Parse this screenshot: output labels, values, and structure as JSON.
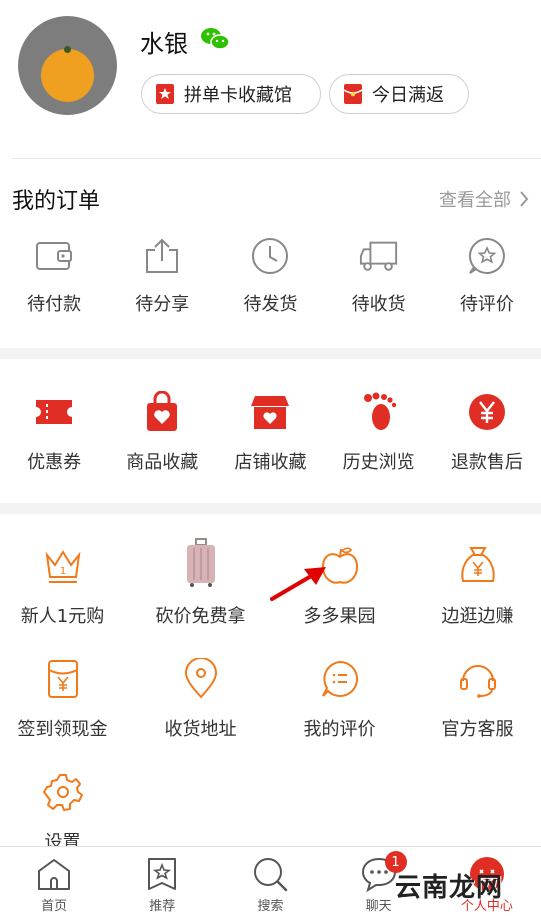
{
  "profile": {
    "username": "水银",
    "chips": [
      {
        "label": "拼单卡收藏馆",
        "icon": "card-icon"
      },
      {
        "label": "今日满返",
        "icon": "red-envelope-icon"
      }
    ]
  },
  "orders": {
    "title": "我的订单",
    "view_all": "查看全部",
    "items": [
      {
        "label": "待付款",
        "icon": "wallet-icon"
      },
      {
        "label": "待分享",
        "icon": "share-icon"
      },
      {
        "label": "待发货",
        "icon": "clock-icon"
      },
      {
        "label": "待收货",
        "icon": "truck-icon"
      },
      {
        "label": "待评价",
        "icon": "star-bubble-icon"
      }
    ]
  },
  "quick": {
    "items": [
      {
        "label": "优惠券",
        "icon": "coupon-icon"
      },
      {
        "label": "商品收藏",
        "icon": "bag-heart-icon"
      },
      {
        "label": "店铺收藏",
        "icon": "shop-heart-icon"
      },
      {
        "label": "历史浏览",
        "icon": "footprint-icon"
      },
      {
        "label": "退款售后",
        "icon": "yuan-circle-icon"
      }
    ]
  },
  "services": {
    "items": [
      {
        "label": "新人1元购",
        "icon": "crown-icon"
      },
      {
        "label": "砍价免费拿",
        "icon": "suitcase-icon"
      },
      {
        "label": "多多果园",
        "icon": "apple-icon"
      },
      {
        "label": "边逛边赚",
        "icon": "money-bag-icon"
      },
      {
        "label": "签到领现金",
        "icon": "envelope-yuan-icon"
      },
      {
        "label": "收货地址",
        "icon": "location-pin-icon"
      },
      {
        "label": "我的评价",
        "icon": "comment-icon"
      },
      {
        "label": "官方客服",
        "icon": "headset-icon"
      },
      {
        "label": "设置",
        "icon": "gear-icon"
      }
    ]
  },
  "tabbar": {
    "items": [
      {
        "label": "首页",
        "icon": "home-icon"
      },
      {
        "label": "推荐",
        "icon": "recommend-icon"
      },
      {
        "label": "搜索",
        "icon": "search-icon"
      },
      {
        "label": "聊天",
        "icon": "chat-icon",
        "badge": "1"
      },
      {
        "label": "个人中心",
        "icon": "profile-icon",
        "active": true
      }
    ]
  },
  "watermark": "云南龙网",
  "colors": {
    "accent": "#e02e24",
    "orange": "#f07a1a"
  }
}
